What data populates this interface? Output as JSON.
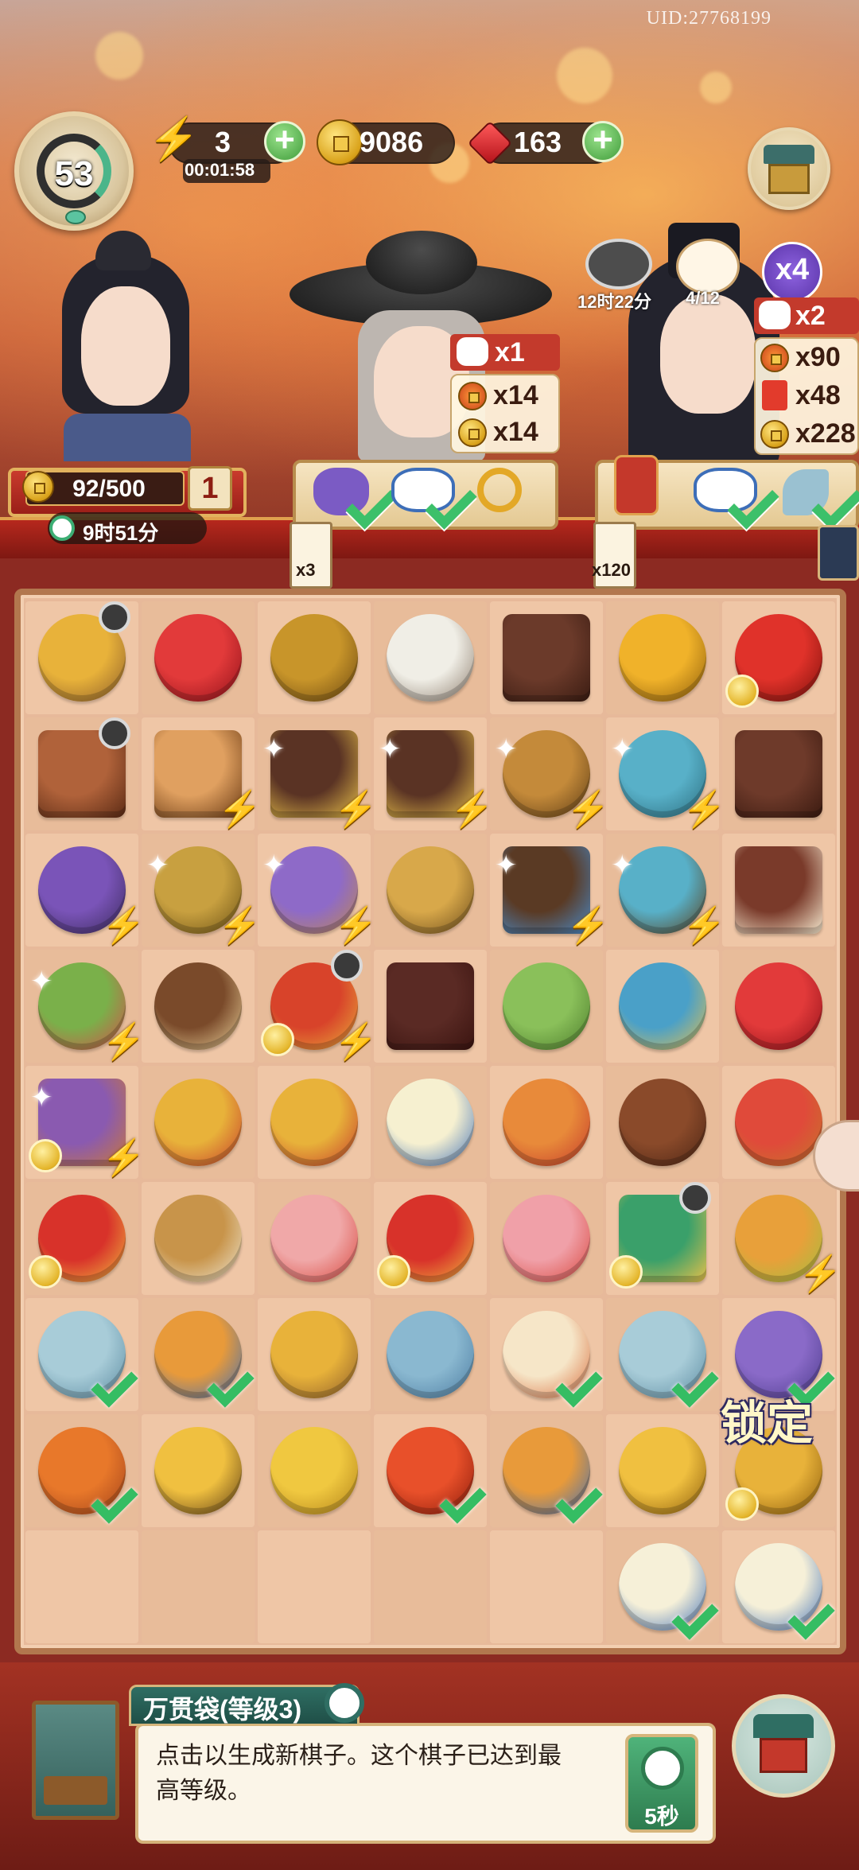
{
  "header": {
    "uid": "UID:27768199",
    "player_level": "53",
    "energy": {
      "value": "3",
      "timer": "00:01:58"
    },
    "coins": "9086",
    "gems": "163"
  },
  "npc_left": {
    "affection": "92/500",
    "level": "1",
    "timer": "9时51分"
  },
  "order_middle": {
    "rewards": [
      "x1",
      "x14",
      "x14"
    ],
    "tag_count": "x3"
  },
  "order_right": {
    "pot_timer": "12时22分",
    "cat_progress": "4/12",
    "multiplier": "x4",
    "rewards": [
      "x2",
      "x90",
      "x48",
      "x228"
    ],
    "tag_count": "x120"
  },
  "board": {
    "lock_label": "锁定",
    "cells": [
      [
        "hen-nest",
        "red-gems",
        "incense-burner",
        "silk-cocoons",
        "wooden-box-closed",
        "gold-energy-vase",
        "red-energy-vase"
      ],
      [
        "chicken-coop",
        "watermelon-crate",
        "treasure-chest-open",
        "treasure-chest-open",
        "scroll-brush-holder",
        "teapot-set",
        "brown-box"
      ],
      [
        "silk-loom",
        "rice-bowl",
        "silk-spool",
        "brush-bundle",
        "jewelry-chest",
        "tea-kettle-stove",
        "tray-box"
      ],
      [
        "fruit-basket",
        "egg-nest",
        "merchant-figure",
        "dark-box",
        "bamboo-slips",
        "tea-jar",
        "red-gems"
      ],
      [
        "scroll-crate",
        "gold-tree",
        "palace-lantern",
        "tea-bowl",
        "fruit-plate",
        "empty-nest",
        "watermelon-platter"
      ],
      [
        "lucky-bag-red",
        "thread-spindle",
        "pink-bun",
        "lucky-bag-gold",
        "pink-buns",
        "jade-box",
        "roast-chicken-plate"
      ],
      [
        "jade-feather",
        "chicken-noodle-bowl",
        "coin-tree",
        "jade-ring",
        "rice-rolls",
        "jade-pendant",
        "purse-purple"
      ],
      [
        "paper-lantern",
        "gold-sprout",
        "gold-leaves",
        "red-lantern",
        "chicken-noodle-bowl",
        "gold-coin",
        "coin-pile"
      ],
      [
        "",
        "",
        "",
        "",
        "",
        "tea-cup",
        "tea-cup-saucer"
      ]
    ]
  },
  "info_panel": {
    "title": "万贯袋(等级3)",
    "description": "点击以生成新棋子。这个棋子已达到最高等级。",
    "timer_label": "5秒"
  },
  "colors": {
    "board_bg": "#e7b99a",
    "accent_red": "#b6281d",
    "accent_green": "#35bd63",
    "accent_teal": "#2f6e63"
  }
}
